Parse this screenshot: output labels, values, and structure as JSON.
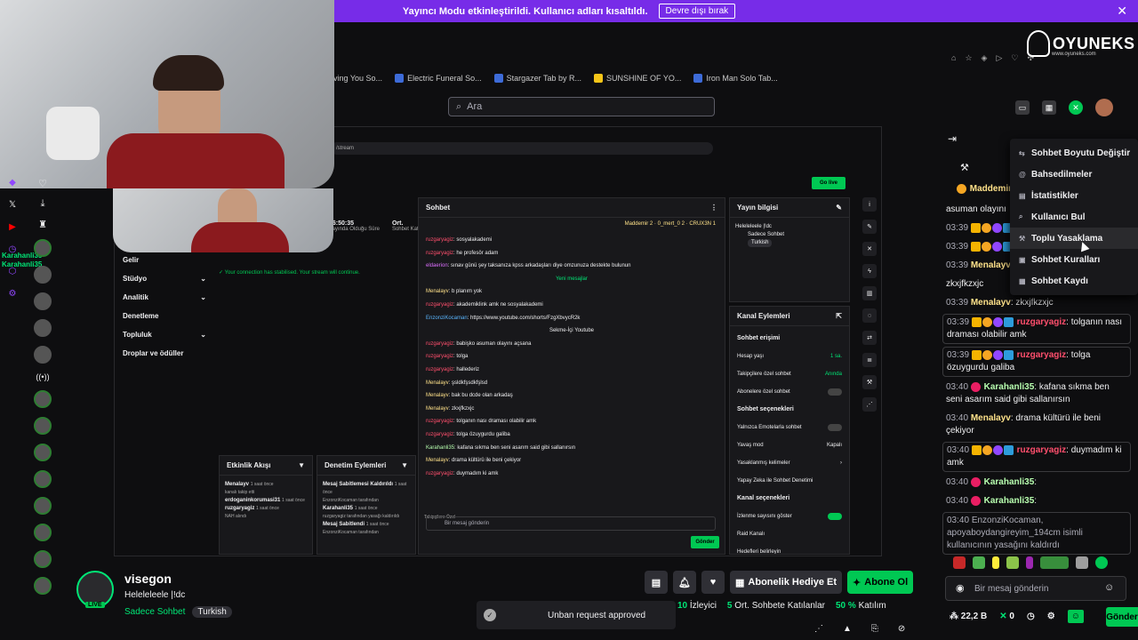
{
  "banner": {
    "text": "Yayıncı Modu etkinleştirildi. Kullanıcı adları kısaltıldı.",
    "button": "Devre dışı bırak",
    "close": "✕"
  },
  "brand": {
    "name": "OYUNEKS",
    "sub": "www.oyuneks.com"
  },
  "bookmarks": [
    {
      "label": "oving You So..."
    },
    {
      "label": "Electric Funeral So..."
    },
    {
      "label": "Stargazer Tab by R..."
    },
    {
      "label": "SUNSHINE OF YO..."
    },
    {
      "label": "Iron Man Solo Tab..."
    }
  ],
  "search": {
    "placeholder": "Ara"
  },
  "dashboard": {
    "url": "/stream",
    "stats": [
      {
        "value": "06:50:35",
        "label": "Yayında Olduğu Süre"
      },
      {
        "value": "Ort.",
        "label": "Sohbet Katılımı"
      }
    ],
    "nav": [
      {
        "label": "Gelir"
      },
      {
        "label": "Stüdyo"
      },
      {
        "label": "Analitik"
      },
      {
        "label": "Denetleme"
      },
      {
        "label": "Topluluk"
      },
      {
        "label": "Droplar ve ödüller"
      }
    ],
    "connection": "Your connection has stabilised. Your stream will continue.",
    "chat": {
      "title": "Sohbet",
      "top_users": [
        "Maddemir 2",
        "0_mert_0 2",
        "CRUX3N 1"
      ],
      "lines": [
        {
          "user": "ruzgaryagiz",
          "text": "sosyalakademi",
          "c": "r"
        },
        {
          "user": "ruzgaryagiz",
          "text": "he profesör adam",
          "c": "r"
        },
        {
          "user": "eldaerion",
          "text": "sınav günü şey taksanıza kpss arkadaşları diye omzunuza destekte bulunun",
          "c": "p"
        },
        {
          "user": "",
          "text": "Yeni mesajlar",
          "c": "div"
        },
        {
          "user": "Menalayv",
          "text": "b planım yok",
          "c": "y"
        },
        {
          "user": "ruzgaryagiz",
          "text": "akademiklink amk ne sosyalakademi",
          "c": "r"
        },
        {
          "user": "EnzonziKocaman",
          "text": "https://www.youtube.com/shorts/FzgXbvycR2k",
          "c": "b"
        },
        {
          "user": "",
          "text": "Sekme-İçi Youtube",
          "c": "yt"
        },
        {
          "user": "ruzgaryagiz",
          "text": "babişko asuman olayını açsana",
          "c": "r"
        },
        {
          "user": "ruzgaryagiz",
          "text": "tolga",
          "c": "r"
        },
        {
          "user": "ruzgaryagiz",
          "text": "hallederiz",
          "c": "r"
        },
        {
          "user": "Menalayv",
          "text": "şsldkfşsdkfşlsd",
          "c": "y"
        },
        {
          "user": "Menalayv",
          "text": "bak bu dcde olan arkadaş",
          "c": "y"
        },
        {
          "user": "Menalayv",
          "text": "zkxjfkzxjc",
          "c": "y"
        },
        {
          "user": "ruzgaryagiz",
          "text": "tolganın nası draması olabilir amk",
          "c": "r"
        },
        {
          "user": "ruzgaryagiz",
          "text": "tolga özuygurdu galiba",
          "c": "r"
        },
        {
          "user": "Karahanli35",
          "text": "kafana sıkma ben seni asarım said gibi sallanırsın",
          "c": "g"
        },
        {
          "user": "Menalayv",
          "text": "drama kültürü ile beni çekiyor",
          "c": "y"
        },
        {
          "user": "ruzgaryagiz",
          "text": "duymadım ki amk",
          "c": "r"
        }
      ],
      "input": "Bir mesaj gönderin",
      "send": "Gönder",
      "followers_only": "Takipçilere Özel"
    },
    "stream_info": {
      "title": "Yayın bilgisi",
      "stream_title": "Heleleleele |!dc",
      "category": "Sadece Sohbet",
      "tag": "Turkish"
    },
    "channel_actions": {
      "title": "Kanal Eylemleri",
      "section1": "Sohbet erişimi",
      "rows1": [
        {
          "label": "Hesap yaşı",
          "value": "1 sa."
        },
        {
          "label": "Takipçilere özel sohbet",
          "value": "Anında"
        },
        {
          "label": "Abonelere özel sohbet",
          "value": ""
        }
      ],
      "section2": "Sohbet seçenekleri",
      "rows2": [
        {
          "label": "Yalnızca Emotelarla sohbet",
          "value": ""
        },
        {
          "label": "Yavaş mod",
          "value": "Kapalı"
        },
        {
          "label": "Yasaklanmış kelimeler",
          "value": ""
        },
        {
          "label": "Yapay Zeka ile Sohbet Denetimi",
          "value": ""
        }
      ],
      "section3": "Kanal seçenekleri",
      "rows3": [
        {
          "label": "İzlenme sayısını göster",
          "value": ""
        },
        {
          "label": "Raid Kanalı",
          "value": ""
        },
        {
          "label": "Hedefleri belirleyin",
          "value": ""
        }
      ]
    },
    "activity": {
      "title": "Etkinlik Akışı",
      "items": [
        {
          "user": "Menalayv",
          "text": "kanalı takip etti",
          "time": "1 saat önce"
        },
        {
          "user": "erdoganinkorumasi31",
          "text": "",
          "time": "1 saat önce"
        },
        {
          "user": "ruzgaryagiz",
          "text": "NAH alındı",
          "time": "1 saat önce"
        }
      ]
    },
    "mod_actions": {
      "title": "Denetim Eylemleri",
      "items": [
        {
          "user": "Mesaj Sabitlemesi Kaldırıldı",
          "text": "EnzonziKocaman tarafından",
          "time": "1 saat önce"
        },
        {
          "user": "Karahanli35",
          "text": "ruzgaryagiz tarafından yasağı kaldırıldı",
          "time": "1 saat önce"
        },
        {
          "user": "Mesaj Sabitlendi",
          "text": "EnzonziKocaman tarafından",
          "time": "1 saat önce"
        }
      ]
    },
    "go_live": "Go live"
  },
  "rail": {
    "live_names": [
      "Karahanli35",
      "Karahanli35"
    ]
  },
  "right_chat": {
    "pinned": "Maddemir",
    "messages": [
      {
        "time": "",
        "user": "",
        "text": "asuman olayını",
        "cls": "plain"
      },
      {
        "time": "03:39",
        "user": "",
        "text": "",
        "cls": "badges"
      },
      {
        "time": "03:39",
        "user": "",
        "text": "",
        "cls": "badges"
      },
      {
        "time": "03:39",
        "user": "Menalayv",
        "text": "",
        "cls": "y"
      },
      {
        "time": "",
        "user": "",
        "text": "zkxjfkzxjc",
        "cls": "plain"
      },
      {
        "time": "03:39",
        "user": "Menalayv",
        "text": "zkxjfkzxjc",
        "cls": "y"
      },
      {
        "time": "03:39",
        "user": "ruzgaryagiz",
        "text": "tolganın nası draması olabilir amk",
        "cls": "r"
      },
      {
        "time": "03:39",
        "user": "ruzgaryagiz",
        "text": "tolga özuygurdu galiba",
        "cls": "r"
      },
      {
        "time": "03:40",
        "user": "Karahanli35",
        "text": "kafana sıkma ben seni asarım said gibi sallanırsın",
        "cls": "g"
      },
      {
        "time": "03:40",
        "user": "Menalayv",
        "text": "drama kültürü ile beni çekiyor",
        "cls": "y"
      },
      {
        "time": "03:40",
        "user": "ruzgaryagiz",
        "text": "duymadım ki amk",
        "cls": "r"
      },
      {
        "time": "03:40",
        "user": "Karahanli35",
        "text": "",
        "cls": "g"
      },
      {
        "time": "03:40",
        "user": "Karahanli35",
        "text": "",
        "cls": "g"
      },
      {
        "time": "03:40",
        "user": "EnzonziKocaman,",
        "text": "apoyaboydangireyim_194cm isimli kullanıcının yasağını kaldırdı",
        "cls": "sys"
      }
    ],
    "input_placeholder": "Bir mesaj gönderin",
    "points": "22,2 B",
    "zero": "0",
    "send": "Gönder"
  },
  "menu": {
    "items": [
      {
        "label": "Sohbet Boyutu Değiştir",
        "icon": "⇆"
      },
      {
        "label": "Bahsedilmeler",
        "icon": "@"
      },
      {
        "label": "İstatistikler",
        "icon": "▤"
      },
      {
        "label": "Kullanıcı Bul",
        "icon": "⌕"
      },
      {
        "label": "Toplu Yasaklama",
        "icon": "⚒"
      },
      {
        "label": "Sohbet Kuralları",
        "icon": "▣"
      },
      {
        "label": "Sohbet Kaydı",
        "icon": "▦"
      }
    ],
    "hovered": 4
  },
  "channel": {
    "name": "visegon",
    "title": "Heleleleele |!dc",
    "category": "Sadece Sohbet",
    "tag": "Turkish",
    "live": "LIVE",
    "gift_label": "Abonelik Hediye Et",
    "sub_label": "Abone Ol",
    "viewers": "10",
    "viewers_label": "İzleyici",
    "chatters": "5",
    "chatters_label": "Ort. Sohbete Katılanlar",
    "participation": "50 %",
    "participation_label": "Katılım"
  },
  "toast": {
    "text": "Unban request approved"
  },
  "colors": {
    "accent": "#00c853",
    "banner": "#772ce8",
    "bg": "#0e0e10"
  }
}
